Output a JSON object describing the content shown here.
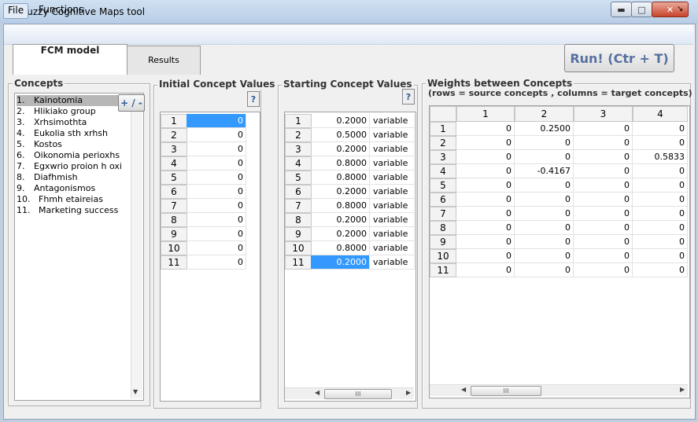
{
  "window": {
    "title": "Fuzzy Cognitive Maps tool",
    "min_icon": "minimize-icon",
    "max_icon": "maximize-icon",
    "close_icon": "close-icon"
  },
  "menu": {
    "file": "File",
    "functions": "Functions"
  },
  "tabs": {
    "fcm": "FCM model",
    "results": "Results"
  },
  "run_button": "Run! (Ctr + T)",
  "concepts": {
    "title": "Concepts",
    "add_remove": "+ / -",
    "items": [
      {
        "num": "1.",
        "name": "Kainotomia"
      },
      {
        "num": "2.",
        "name": "Hlikiako group"
      },
      {
        "num": "3.",
        "name": "Xrhsimothta"
      },
      {
        "num": "4.",
        "name": "Eukolia sth xrhsh"
      },
      {
        "num": "5.",
        "name": "Kostos"
      },
      {
        "num": "6.",
        "name": "Oikonomia perioxhs"
      },
      {
        "num": "7.",
        "name": "Egxwrio proion h oxi"
      },
      {
        "num": "8.",
        "name": "Diafhmish"
      },
      {
        "num": "9.",
        "name": "Antagonismos"
      },
      {
        "num": "10.",
        "name": "Fhmh etaireias"
      },
      {
        "num": "11.",
        "name": "Marketing success"
      }
    ]
  },
  "initial": {
    "title": "Initial Concept Values",
    "help": "?",
    "rows": [
      "1",
      "2",
      "3",
      "4",
      "5",
      "6",
      "7",
      "8",
      "9",
      "10",
      "11"
    ],
    "values": [
      "0",
      "0",
      "0",
      "0",
      "0",
      "0",
      "0",
      "0",
      "0",
      "0",
      "0"
    ]
  },
  "starting": {
    "title": "Starting Concept Values",
    "help": "?",
    "rows": [
      "1",
      "2",
      "3",
      "4",
      "5",
      "6",
      "7",
      "8",
      "9",
      "10",
      "11"
    ],
    "values": [
      "0.2000",
      "0.5000",
      "0.2000",
      "0.8000",
      "0.8000",
      "0.2000",
      "0.8000",
      "0.2000",
      "0.2000",
      "0.8000",
      "0.2000"
    ],
    "type": "variable"
  },
  "weights": {
    "title": "Weights between Concepts",
    "subtitle": "(rows = source concepts , columns = target concepts)",
    "columns": [
      "1",
      "2",
      "3",
      "4"
    ],
    "rows": [
      "1",
      "2",
      "3",
      "4",
      "5",
      "6",
      "7",
      "8",
      "9",
      "10",
      "11"
    ],
    "cells": [
      [
        "0",
        "0.2500",
        "0",
        "0"
      ],
      [
        "0",
        "0",
        "0",
        "0"
      ],
      [
        "0",
        "0",
        "0",
        "0.5833"
      ],
      [
        "0",
        "-0.4167",
        "0",
        "0"
      ],
      [
        "0",
        "0",
        "0",
        "0"
      ],
      [
        "0",
        "0",
        "0",
        "0"
      ],
      [
        "0",
        "0",
        "0",
        "0"
      ],
      [
        "0",
        "0",
        "0",
        "0"
      ],
      [
        "0",
        "0",
        "0",
        "0"
      ],
      [
        "0",
        "0",
        "0",
        "0"
      ],
      [
        "0",
        "0",
        "0",
        "0"
      ]
    ]
  },
  "scroll_grip": "III"
}
